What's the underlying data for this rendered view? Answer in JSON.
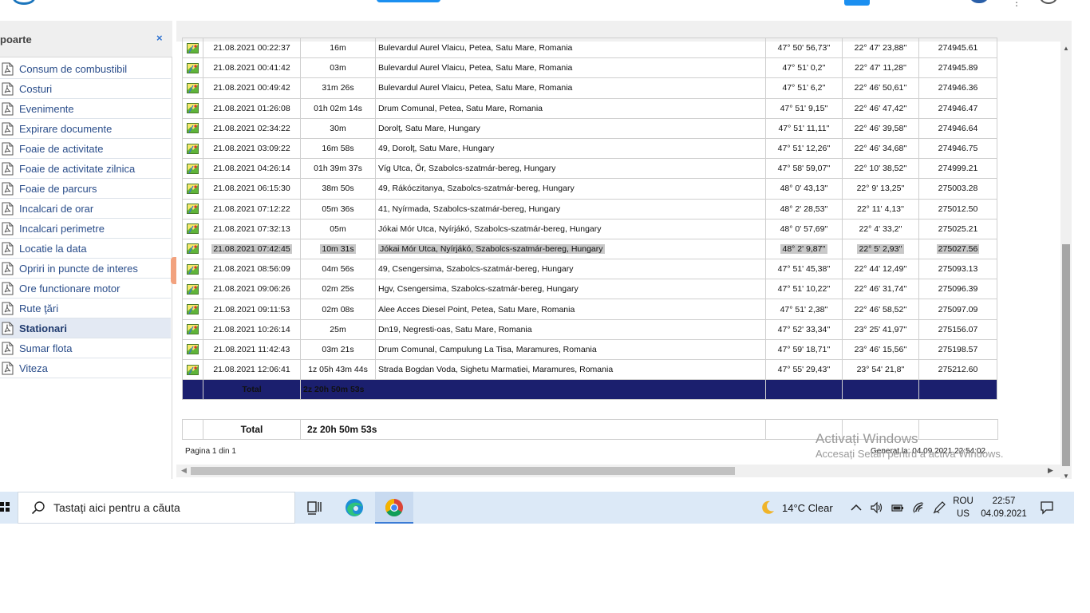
{
  "reports_panel": {
    "title": "poarte",
    "close_label": "×",
    "items": [
      {
        "label": "Consum de combustibil"
      },
      {
        "label": "Costuri"
      },
      {
        "label": "Evenimente"
      },
      {
        "label": "Expirare documente"
      },
      {
        "label": "Foaie de activitate"
      },
      {
        "label": "Foaie de activitate zilnica"
      },
      {
        "label": "Foaie de parcurs"
      },
      {
        "label": "Incalcari de orar"
      },
      {
        "label": "Incalcari perimetre"
      },
      {
        "label": "Locatie la data"
      },
      {
        "label": "Opriri in puncte de interes"
      },
      {
        "label": "Ore functionare motor"
      },
      {
        "label": "Rute ţări"
      },
      {
        "label": "Stationari"
      },
      {
        "label": "Sumar flota"
      },
      {
        "label": "Viteza"
      }
    ],
    "active_item": "Stationari"
  },
  "table": {
    "rows": [
      {
        "date": "21.08.2021 00:22:37",
        "duration": "16m",
        "address": "Bulevardul Aurel Vlaicu,   Petea, Satu Mare, Romania",
        "lat": "47° 50' 56,73''",
        "lon": "22° 47' 23,88''",
        "km": "274945.61"
      },
      {
        "date": "21.08.2021 00:41:42",
        "duration": "03m",
        "address": "Bulevardul Aurel Vlaicu,   Petea, Satu Mare, Romania",
        "lat": "47° 51' 0,2''",
        "lon": "22° 47' 11,28''",
        "km": "274945.89"
      },
      {
        "date": "21.08.2021 00:49:42",
        "duration": "31m 26s",
        "address": "Bulevardul Aurel Vlaicu,   Petea, Satu Mare, Romania",
        "lat": "47° 51' 6,2''",
        "lon": "22° 46' 50,61''",
        "km": "274946.36"
      },
      {
        "date": "21.08.2021 01:26:08",
        "duration": "01h 02m 14s",
        "address": "Drum Comunal,   Petea, Satu Mare, Romania",
        "lat": "47° 51' 9,15''",
        "lon": "22° 46' 47,42''",
        "km": "274946.47"
      },
      {
        "date": "21.08.2021 02:34:22",
        "duration": "30m",
        "address": "Dorolţ, Satu Mare, Hungary",
        "lat": "47° 51' 11,11''",
        "lon": "22° 46' 39,58''",
        "km": "274946.64"
      },
      {
        "date": "21.08.2021 03:09:22",
        "duration": "16m 58s",
        "address": "49,   Dorolţ, Satu Mare, Hungary",
        "lat": "47° 51' 12,26''",
        "lon": "22° 46' 34,68''",
        "km": "274946.75"
      },
      {
        "date": "21.08.2021 04:26:14",
        "duration": "01h 39m 37s",
        "address": "Víg Utca,   Őr, Szabolcs-szatmár-bereg, Hungary",
        "lat": "47° 58' 59,07''",
        "lon": "22° 10' 38,52''",
        "km": "274999.21"
      },
      {
        "date": "21.08.2021 06:15:30",
        "duration": "38m 50s",
        "address": "49,   Rákóczitanya, Szabolcs-szatmár-bereg, Hungary",
        "lat": "48° 0' 43,13''",
        "lon": "22° 9' 13,25''",
        "km": "275003.28"
      },
      {
        "date": "21.08.2021 07:12:22",
        "duration": "05m 36s",
        "address": "41,   Nyírmada, Szabolcs-szatmár-bereg, Hungary",
        "lat": "48° 2' 28,53''",
        "lon": "22° 11' 4,13''",
        "km": "275012.50"
      },
      {
        "date": "21.08.2021 07:32:13",
        "duration": "05m",
        "address": "Jókai Mór Utca,   Nyírjákó, Szabolcs-szatmár-bereg, Hungary",
        "lat": "48° 0' 57,69''",
        "lon": "22° 4' 33,2''",
        "km": "275025.21"
      },
      {
        "date": "21.08.2021 07:42:45",
        "duration": "10m 31s",
        "address": "Jókai Mór Utca,   Nyírjákó, Szabolcs-szatmár-bereg, Hungary",
        "lat": "48° 2' 9,87''",
        "lon": "22° 5' 2,93''",
        "km": "275027.56"
      },
      {
        "date": "21.08.2021 08:56:09",
        "duration": "04m 56s",
        "address": "49,   Csengersima, Szabolcs-szatmár-bereg, Hungary",
        "lat": "47° 51' 45,38''",
        "lon": "22° 44' 12,49''",
        "km": "275093.13"
      },
      {
        "date": "21.08.2021 09:06:26",
        "duration": "02m 25s",
        "address": "Hgv,   Csengersima, Szabolcs-szatmár-bereg, Hungary",
        "lat": "47° 51' 10,22''",
        "lon": "22° 46' 31,74''",
        "km": "275096.39"
      },
      {
        "date": "21.08.2021 09:11:53",
        "duration": "02m 08s",
        "address": "Alee Acces Diesel Point,   Petea, Satu Mare, Romania",
        "lat": "47° 51' 2,38''",
        "lon": "22° 46' 58,52''",
        "km": "275097.09"
      },
      {
        "date": "21.08.2021 10:26:14",
        "duration": "25m",
        "address": "Dn19,   Negresti-oas, Satu Mare, Romania",
        "lat": "47° 52' 33,34''",
        "lon": "23° 25' 41,97''",
        "km": "275156.07"
      },
      {
        "date": "21.08.2021 11:42:43",
        "duration": "03m 21s",
        "address": "Drum Comunal,   Campulung La Tisa, Maramures, Romania",
        "lat": "47° 59' 18,71''",
        "lon": "23° 46' 15,56''",
        "km": "275198.57"
      },
      {
        "date": "21.08.2021 12:06:41",
        "duration": "1z 05h 43m 44s",
        "address": "Strada Bogdan Voda,   Sighetu Marmatiei, Maramures, Romania",
        "lat": "47° 55' 29,43''",
        "lon": "23° 54' 21,8''",
        "km": "275212.60"
      }
    ],
    "highlighted_row_index": 10,
    "total_label": "Total",
    "total_value": "2z 20h 50m 53s"
  },
  "summary": {
    "total_label": "Total",
    "total_value": "2z 20h 50m 53s"
  },
  "footer": {
    "page_info": "Pagina 1 din 1",
    "generated": "Generat la: 04.09.2021 22:54:02"
  },
  "watermark": {
    "title": "Activați Windows",
    "subtitle": "Accesați Setări pentru a activa Windows."
  },
  "taskbar": {
    "search_placeholder": "Tastați aici pentru a căuta",
    "weather": "14°C  Clear",
    "lang_top": "ROU",
    "lang_bottom": "US",
    "time": "22:57",
    "date": "04.09.2021"
  },
  "colors": {
    "total_bar": "#1b1f6e",
    "link_text": "#2a4d8a",
    "taskbar_bg": "#dce9f7",
    "accent_blue": "#1b75bc"
  }
}
